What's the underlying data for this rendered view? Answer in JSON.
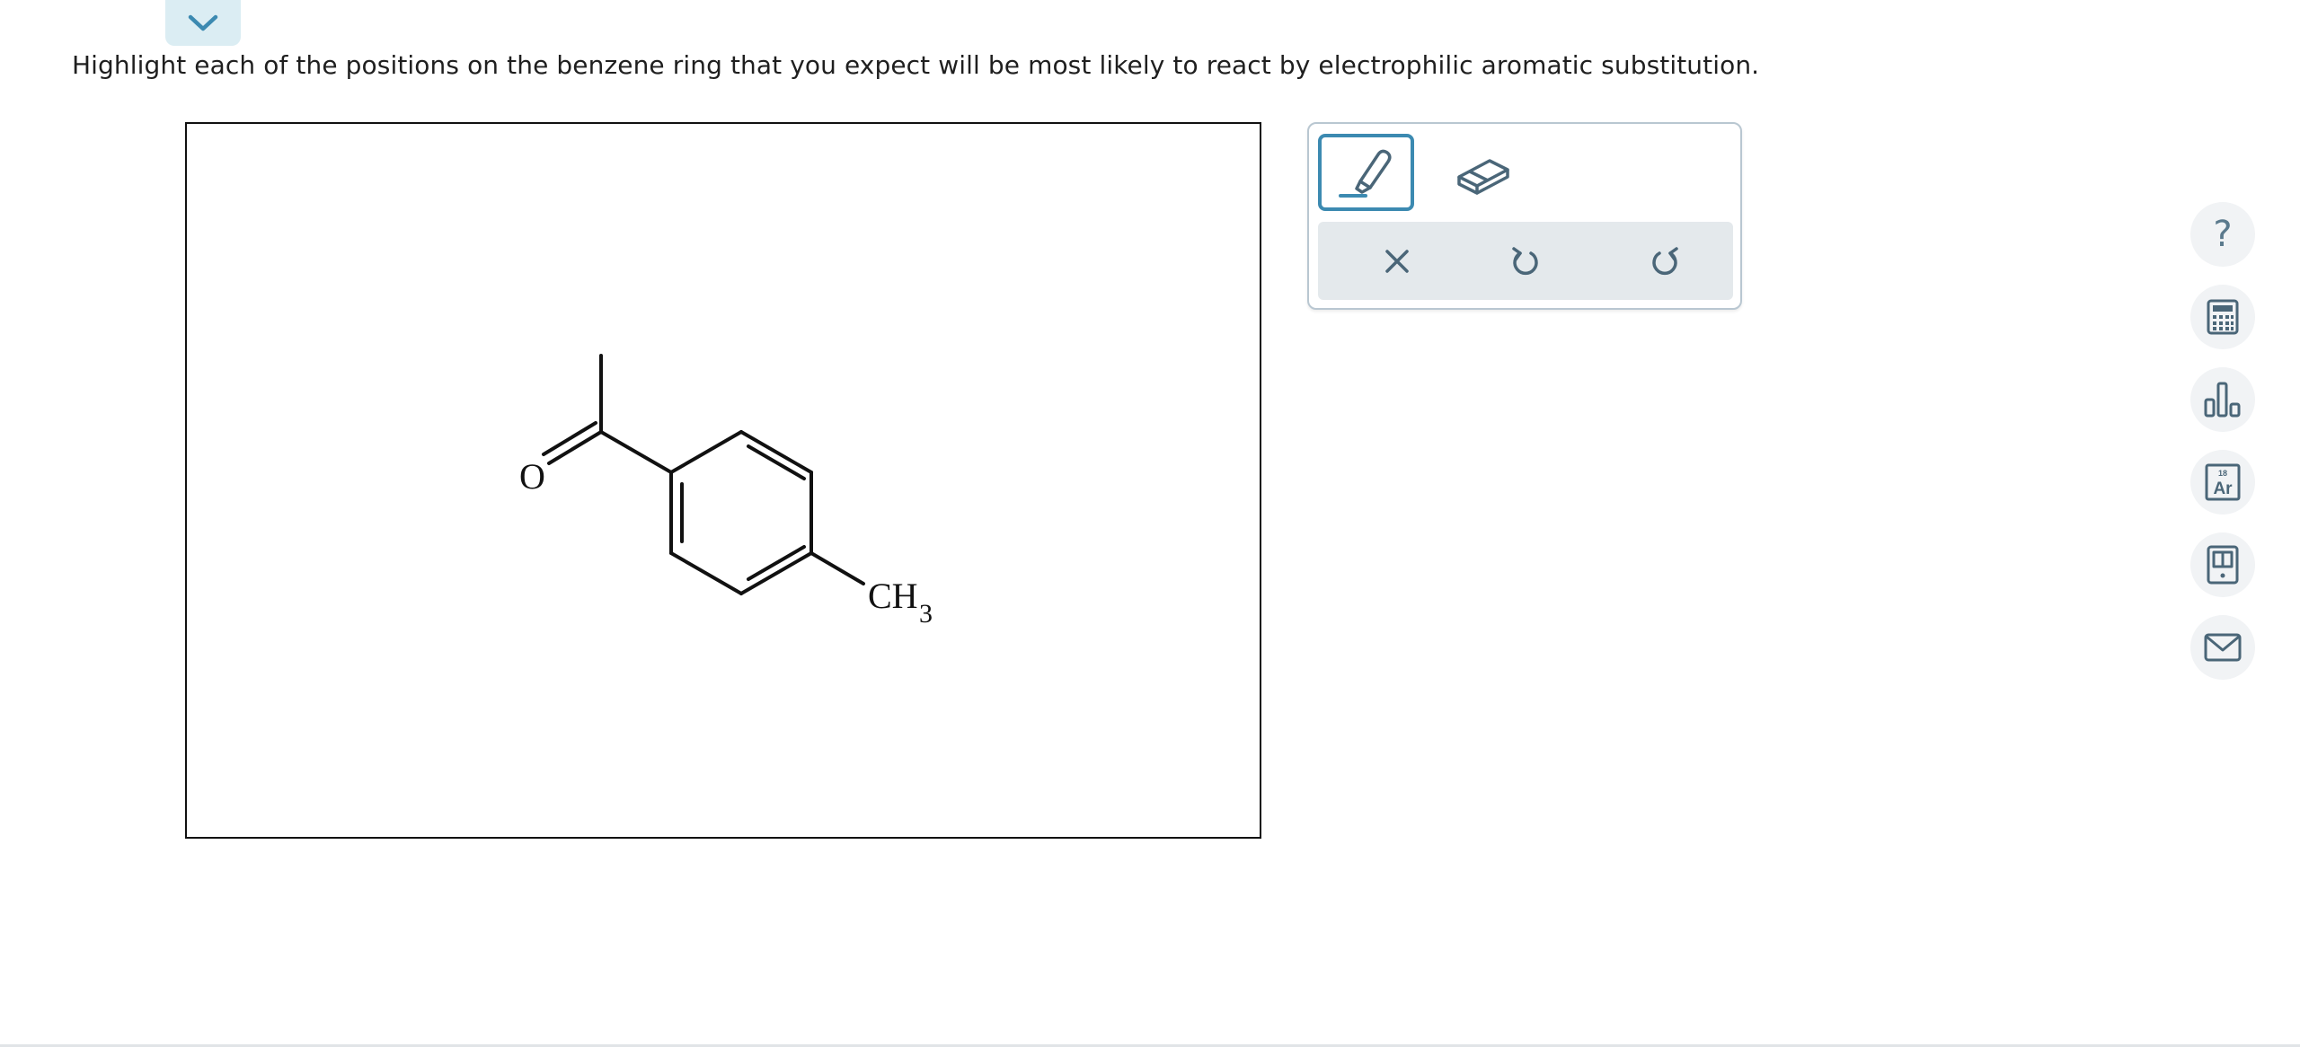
{
  "question": {
    "text": "Highlight each of the positions on the benzene ring that you expect will be most likely to react by electrophilic aromatic substitution."
  },
  "molecule": {
    "atom_labels": {
      "oxygen": "O",
      "methyl_main": "CH",
      "methyl_subscript": "3"
    }
  },
  "tools": {
    "selected": "highlighter",
    "items": [
      {
        "name": "highlighter",
        "icon": "highlighter-icon",
        "selected": true
      },
      {
        "name": "eraser",
        "icon": "eraser-icon",
        "selected": false
      }
    ],
    "actions": [
      {
        "name": "clear",
        "icon": "close-icon"
      },
      {
        "name": "undo",
        "icon": "undo-icon"
      },
      {
        "name": "redo",
        "icon": "redo-icon"
      }
    ]
  },
  "sidebar": {
    "help_symbol": "?",
    "periodic_label_number": "18",
    "periodic_label_symbol": "Ar",
    "items": [
      {
        "name": "help",
        "icon": "help-icon"
      },
      {
        "name": "calculator",
        "icon": "calculator-icon"
      },
      {
        "name": "data",
        "icon": "bar-chart-icon"
      },
      {
        "name": "periodic-table",
        "icon": "periodic-table-icon"
      },
      {
        "name": "textbook",
        "icon": "book-icon"
      },
      {
        "name": "message",
        "icon": "mail-icon"
      }
    ]
  },
  "colors": {
    "accent": "#3c8ab1",
    "icon": "#4a6678",
    "action_bar": "#e4e9ec",
    "collapse_tab": "#dbedf3"
  }
}
